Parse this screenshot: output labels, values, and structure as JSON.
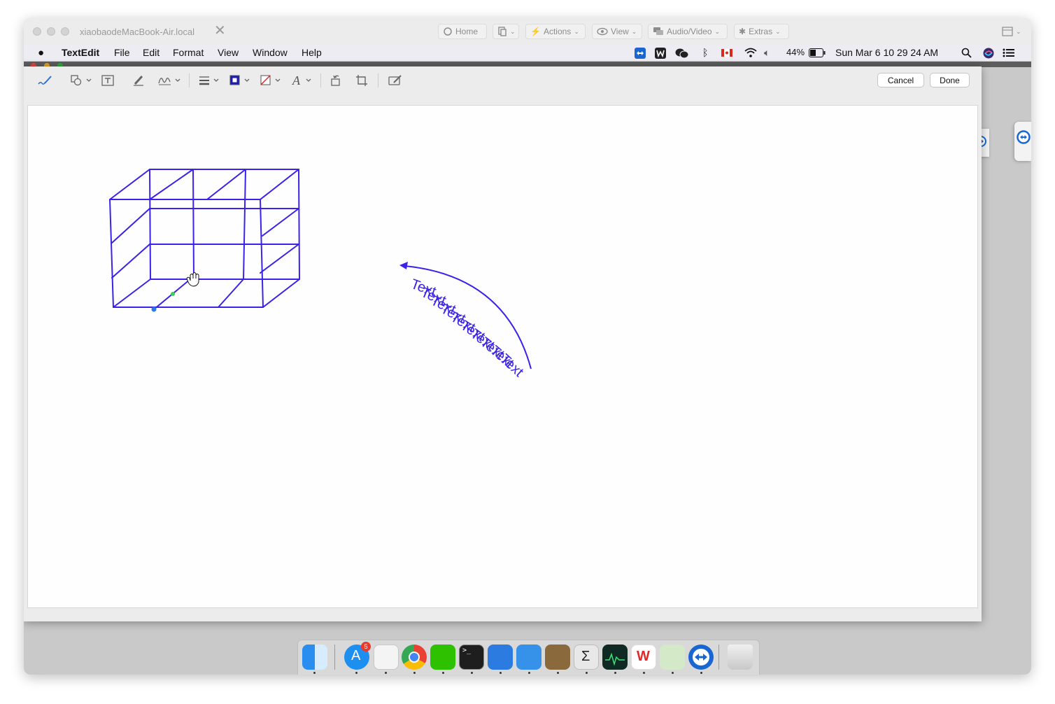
{
  "remote": {
    "host": "xiaobaodeMacBook-Air.local",
    "toolbar": {
      "home": "Home",
      "actions": "Actions",
      "view": "View",
      "audio_video": "Audio/Video",
      "extras": "Extras"
    }
  },
  "menubar": {
    "app": "TextEdit",
    "items": [
      "File",
      "Edit",
      "Format",
      "View",
      "Window",
      "Help"
    ],
    "battery": "44%",
    "datetime": "Sun Mar 6  10 29 24 AM"
  },
  "markup": {
    "cancel_label": "Cancel",
    "done_label": "Done",
    "stroke_color": "#3a22e8",
    "text_on_path": "Text",
    "text_on_path_count": 10
  },
  "dock": {
    "apps": [
      "finder",
      "app-store",
      "textedit",
      "chrome",
      "wechat",
      "terminal",
      "xcode-tools",
      "xcode",
      "notes-app",
      "calculator",
      "activity-monitor",
      "wps",
      "preview",
      "teamviewer",
      "trash"
    ],
    "app_store_badge": "5"
  }
}
